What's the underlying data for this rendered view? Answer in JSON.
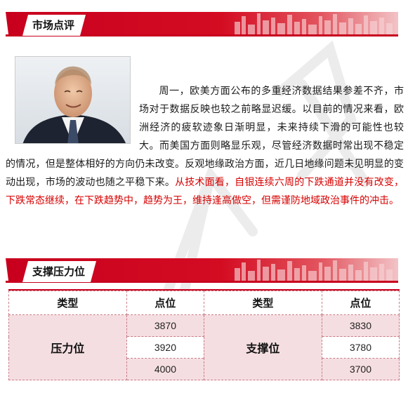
{
  "sections": {
    "market_comment": "市场点评",
    "support_resistance": "支撑压力位"
  },
  "photo": {
    "alt": "portrait photo"
  },
  "article": {
    "p1": "周一，欧美方面公布的多重经济数据结果参差不齐，市场对于数据反映也较之前略显迟缓。以目前的情况来看，欧洲经济的疲软迹象日渐明显，未来持续下滑的可能性也较大。而美国方面则略显乐观，尽管经济数据时常出现不稳定的情况，但是整体相好的方向仍未改变。反观地缘政治方面，近几日地缘问题未见明显的变动出现，市场的波动也随之平稳下来。",
    "p1_red": "从技术面看，自银连续六周的下跌通道并没有改变，下跌常态继续，在下跌趋势中，趋势为王，维持逢高做空，但需谨防地域政治事件的冲击。"
  },
  "table": {
    "headers": [
      "类型",
      "点位",
      "类型",
      "点位"
    ],
    "resistance": {
      "label": "压力位",
      "values": [
        "3870",
        "3920",
        "4000"
      ]
    },
    "support": {
      "label": "支撑位",
      "values": [
        "3830",
        "3780",
        "3700"
      ]
    }
  },
  "colors": {
    "accent": "#c8001e",
    "table_pink": "#f5dee1",
    "highlight_text": "#d60000"
  }
}
